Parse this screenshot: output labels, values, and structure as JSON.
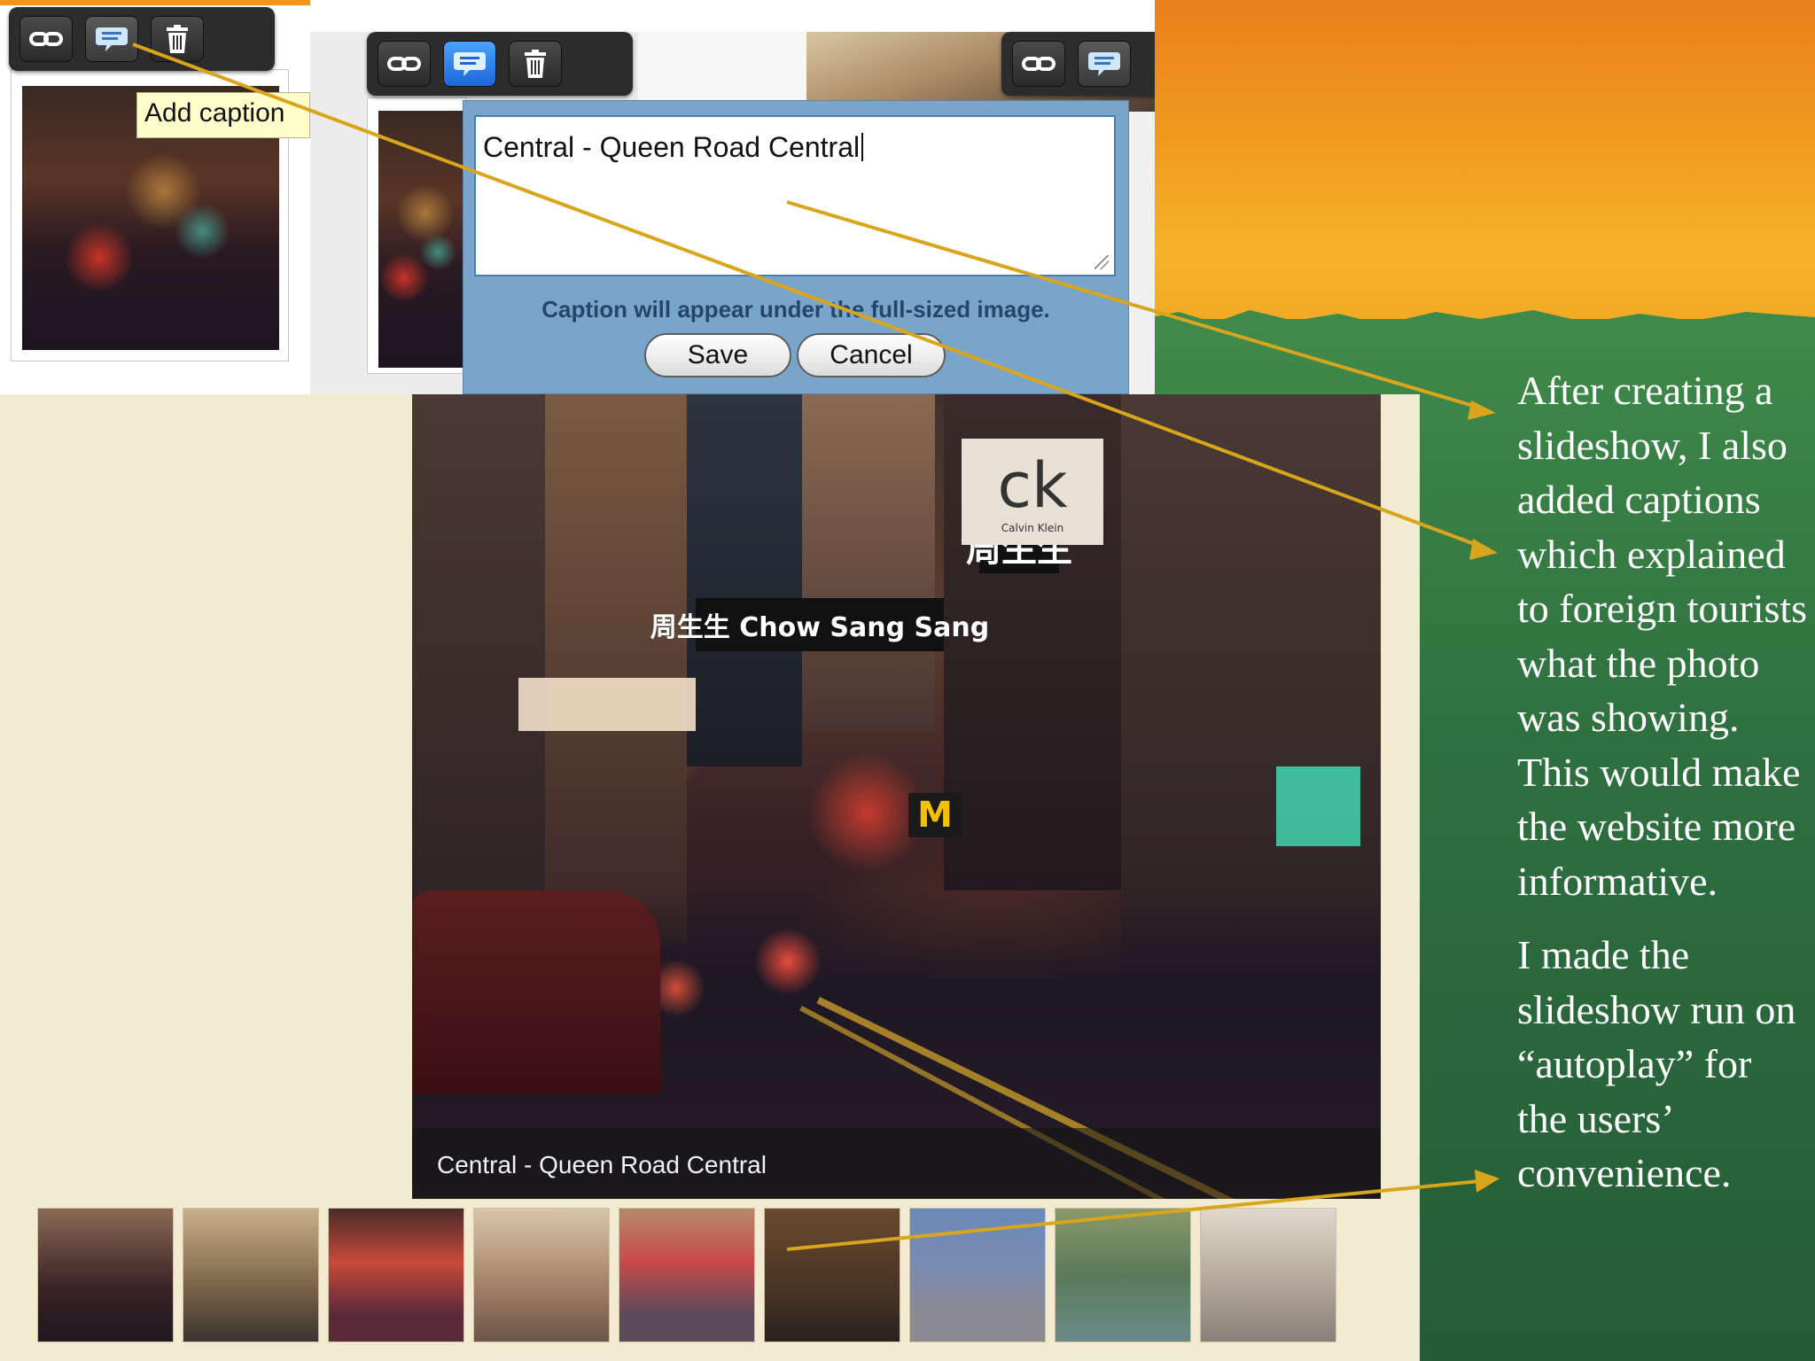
{
  "editor": {
    "tooltip": "Add caption",
    "caption_value": "Central - Queen Road Central",
    "caption_hint": "Caption will appear under the full-sized image.",
    "save_label": "Save",
    "cancel_label": "Cancel",
    "toolbar_icons": [
      "link-icon",
      "comment-icon",
      "trash-icon"
    ]
  },
  "slideshow": {
    "caption": "Central - Queen Road Central",
    "signs": {
      "jeweler_cn": "周生生",
      "jeweler_en": "周生生 Chow Sang Sang",
      "brand": "ck",
      "brand_sub": "Calvin Klein",
      "mcd": "M"
    },
    "thumbnail_count": 9
  },
  "notes": {
    "paragraph1": "After creating a slideshow, I also added captions which explained to foreign tourists what the photo was showing. This would make the website more informative.",
    "paragraph2": "I made the slideshow run on “autoplay” for the users’ convenience."
  },
  "colors": {
    "annotation_arrow": "#d8a51c",
    "active_button": "#1c66d8",
    "dialog": "#7aa5cb",
    "slide_green": "#2e6a3c",
    "slide_orange": "#f09a1e"
  }
}
